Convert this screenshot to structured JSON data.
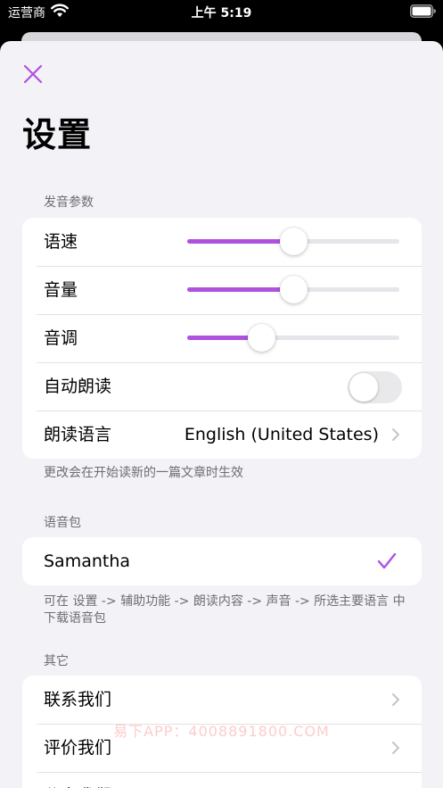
{
  "status_bar": {
    "carrier": "运营商",
    "time": "上午 5:19"
  },
  "title": "设置",
  "sections": {
    "voice_params": {
      "header": "发音参数",
      "speed": {
        "label": "语速",
        "value": 0.5
      },
      "volume": {
        "label": "音量",
        "value": 0.5
      },
      "pitch": {
        "label": "音调",
        "value": 0.35
      },
      "auto_read": {
        "label": "自动朗读",
        "on": false
      },
      "language": {
        "label": "朗读语言",
        "value": "English (United States)"
      },
      "footer": "更改会在开始读新的一篇文章时生效"
    },
    "voice_pack": {
      "header": "语音包",
      "selected": "Samantha",
      "footer": "可在 设置 -> 辅助功能 -> 朗读内容 -> 声音 -> 所选主要语言 中下载语音包"
    },
    "other": {
      "header": "其它",
      "contact": "联系我们",
      "rate": "评价我们",
      "share": "分享我们"
    }
  },
  "colors": {
    "accent": "#af52de",
    "background": "#f2f2f7",
    "toggle_off": "#e9e9eb"
  },
  "icons": {
    "close": "close-icon",
    "chevron": "chevron-right-icon",
    "check": "checkmark-icon"
  },
  "watermark": "易下APP：4008891800.COM"
}
